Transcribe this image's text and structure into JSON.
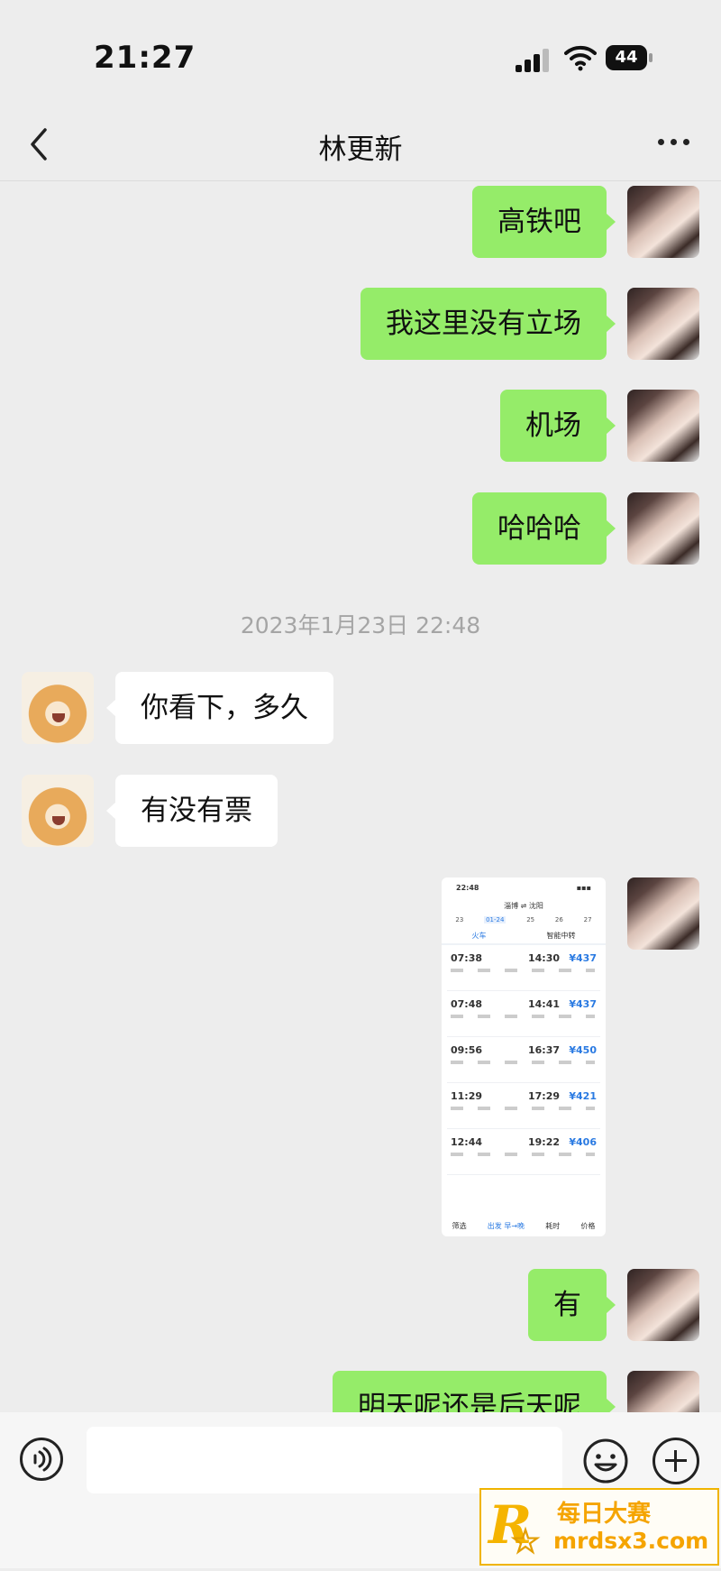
{
  "status_bar": {
    "time": "21:27",
    "battery": "44"
  },
  "nav": {
    "title": "林更新"
  },
  "messages": [
    {
      "side": "me",
      "text": "高铁吧"
    },
    {
      "side": "me",
      "text": "我这里没有立场"
    },
    {
      "side": "me",
      "text": "机场"
    },
    {
      "side": "me",
      "text": "哈哈哈"
    },
    {
      "timestamp": "2023年1月23日 22:48"
    },
    {
      "side": "other",
      "text": "你看下，多久"
    },
    {
      "side": "other",
      "text": "有没有票"
    },
    {
      "side": "me",
      "type": "image"
    },
    {
      "side": "me",
      "text": "有"
    },
    {
      "side": "me",
      "text": "明天呢还是后天呢"
    }
  ],
  "shared_screenshot": {
    "time": "22:48",
    "route": "淄博 ⇌ 沈阳",
    "dates": [
      "23",
      "01-24",
      "25",
      "26",
      "27"
    ],
    "tabs": [
      "火车",
      "智能中转"
    ],
    "trains": [
      {
        "depart": "07:38",
        "arrive": "14:30",
        "price": "¥437"
      },
      {
        "depart": "07:48",
        "arrive": "14:41",
        "price": "¥437"
      },
      {
        "depart": "09:56",
        "arrive": "16:37",
        "price": "¥450"
      },
      {
        "depart": "11:29",
        "arrive": "17:29",
        "price": "¥421"
      },
      {
        "depart": "12:44",
        "arrive": "19:22",
        "price": "¥406"
      }
    ],
    "bottom_tabs": [
      "筛选",
      "出发 早→晚",
      "耗时",
      "价格"
    ]
  },
  "watermark": {
    "name": "每日大赛",
    "url": "mrdsx3.com"
  },
  "colors": {
    "bubble_me": "#95ec69",
    "bubble_other": "#ffffff",
    "background": "#ededed"
  },
  "icons": [
    "back-icon",
    "more-icon",
    "voice-icon",
    "emoji-icon",
    "plus-icon"
  ]
}
